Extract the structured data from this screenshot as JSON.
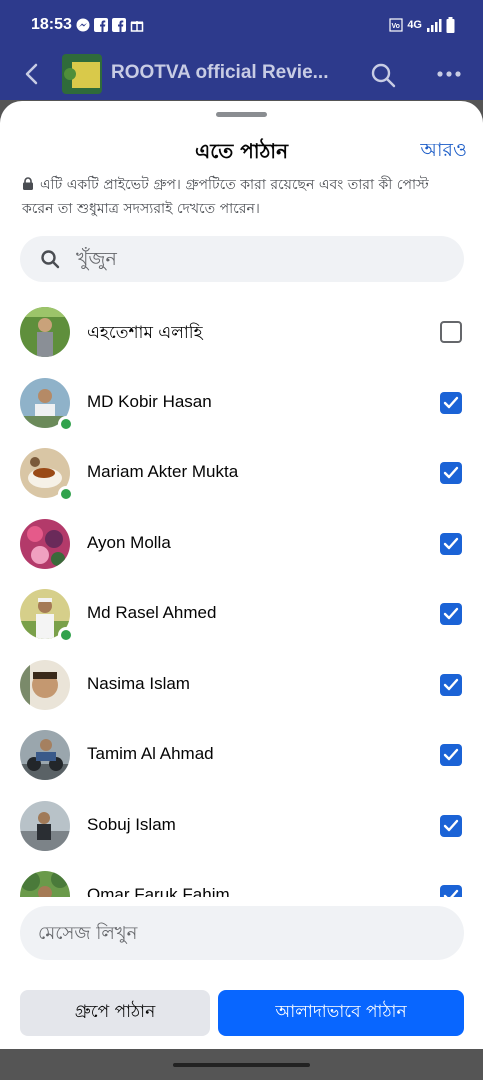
{
  "status_bar": {
    "time": "18:53",
    "network": "4G"
  },
  "header": {
    "group_name": "ROOTVA official Revie..."
  },
  "sheet": {
    "title": "এতে পাঠান",
    "more_label": "আরও",
    "privacy_text": "এটি একটি প্রাইভেট গ্রুপ। গ্রুপটিতে কারা রয়েছেন এবং তারা কী পোস্ট করেন তা শুধুমাত্র সদস্যরাই দেখতে পারেন।",
    "search_placeholder": "খুঁজুন",
    "message_placeholder": "মেসেজ লিখুন",
    "send_group_label": "গ্রুপে পাঠান",
    "send_separately_label": "আলাদাভাবে পাঠান"
  },
  "contacts": [
    {
      "name": "এহতেশাম এলাহি",
      "checked": false,
      "online": false,
      "avatar": "person-outdoors-green"
    },
    {
      "name": "MD Kobir Hasan",
      "checked": true,
      "online": true,
      "avatar": "person-white-shirt"
    },
    {
      "name": "Mariam Akter Mukta",
      "checked": true,
      "online": true,
      "avatar": "tea-cup"
    },
    {
      "name": "Ayon Molla",
      "checked": true,
      "online": false,
      "avatar": "colorful-flowers"
    },
    {
      "name": "Md Rasel Ahmed",
      "checked": true,
      "online": true,
      "avatar": "person-cap-field"
    },
    {
      "name": "Nasima Islam",
      "checked": true,
      "online": false,
      "avatar": "child-face"
    },
    {
      "name": "Tamim Al Ahmad",
      "checked": true,
      "online": false,
      "avatar": "motorbike-rider"
    },
    {
      "name": "Sobuj Islam",
      "checked": true,
      "online": false,
      "avatar": "person-on-road"
    },
    {
      "name": "Omar Faruk Fahim",
      "checked": true,
      "online": false,
      "avatar": "person-trees"
    }
  ],
  "colors": {
    "accent": "#0866ff",
    "checkbox": "#1b63d6",
    "online": "#31a24c",
    "header_bg": "#2d3a8c"
  }
}
